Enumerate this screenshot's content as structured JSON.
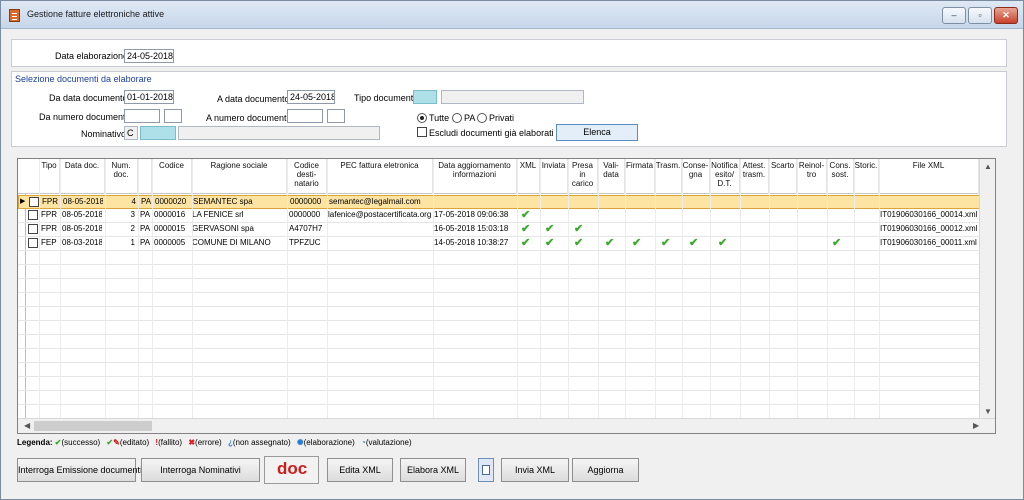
{
  "window": {
    "title": "Gestione fatture elettroniche attive",
    "min": "–",
    "max": "▫",
    "close": "✕"
  },
  "top": {
    "data_elab_label": "Data elaborazione:",
    "data_elab_value": "24-05-2018"
  },
  "selection": {
    "title": "Selezione documenti da elaborare",
    "da_data_label": "Da data documento:",
    "da_data_value": "01-01-2018",
    "a_data_label": "A data documento:",
    "a_data_value": "24-05-2018",
    "tipo_label": "Tipo documento:",
    "da_num_label": "Da numero documento:",
    "a_num_label": "A numero documento:",
    "nominativo_label": "Nominativo:",
    "nominativo_code": "C",
    "radio_tutte": "Tutte",
    "radio_pa": "PA",
    "radio_privati": "Privati",
    "escludi_label": "Escludi documenti già elaborati",
    "elenca_label": "Elenca"
  },
  "grid": {
    "columns": [
      "Tipo",
      "Data doc.",
      "Num. doc.",
      "",
      "Codice",
      "Ragione sociale",
      "Codice desti- natario",
      "PEC fattura eletronica",
      "Data aggiornamento informazioni",
      "XML",
      "Inviata",
      "Presa in carico",
      "Vali- data",
      "Firmata",
      "Trasm.",
      "Conse- gna",
      "Notifica esito/ D.T.",
      "Attest. trasm.",
      "Scarto",
      "Reinol- tro",
      "Cons. sost.",
      "Storic.",
      "File XML"
    ],
    "rows": [
      {
        "tipo": "FPR",
        "data": "08-05-2018",
        "num": "4",
        "pa": "PA",
        "codice": "0000020",
        "ragione": "SEMANTEC spa",
        "dest": "0000000",
        "pec": "semantec@legalmail.com",
        "agg": "",
        "file": "",
        "checks": []
      },
      {
        "tipo": "FPR",
        "data": "08-05-2018",
        "num": "3",
        "pa": "PA",
        "codice": "0000016",
        "ragione": "LA FENICE srl",
        "dest": "0000000",
        "pec": "lafenice@postacertificata.org",
        "agg": "17-05-2018 09:06:38",
        "file": "IT01906030166_00014.xml",
        "checks": [
          "xml"
        ]
      },
      {
        "tipo": "FPR",
        "data": "08-05-2018",
        "num": "2",
        "pa": "PA",
        "codice": "0000015",
        "ragione": "GERVASONI spa",
        "dest": "A4707H7",
        "pec": "",
        "agg": "16-05-2018 15:03:18",
        "file": "IT01906030166_00012.xml",
        "checks": [
          "xml",
          "inviata",
          "presa"
        ]
      },
      {
        "tipo": "FEP",
        "data": "08-03-2018",
        "num": "1",
        "pa": "PA",
        "codice": "0000005",
        "ragione": "COMUNE DI MILANO",
        "dest": "TPFZUC",
        "pec": "",
        "agg": "14-05-2018 10:38:27",
        "file": "IT01906030166_00011.xml",
        "checks": [
          "xml",
          "inviata",
          "presa",
          "validata",
          "firmata",
          "trasm",
          "consegna",
          "notifica",
          "cons"
        ]
      }
    ],
    "check_glyph": "✔"
  },
  "legend": {
    "title": "Legenda:",
    "successo": "(successo)",
    "editato": "(editato)",
    "fallito": "(fallito)",
    "errore": "(errore)",
    "non_assegnato": "(non assegnato)",
    "elaborazione": "(elaborazione)",
    "valutazione": "(valutazione)"
  },
  "buttons": {
    "interroga_emissione": "Interroga Emissione documenti",
    "interroga_nominativi": "Interroga Nominativi",
    "doc": "doc",
    "edita_xml": "Edita XML",
    "elabora_xml": "Elabora XML",
    "invia_xml": "Invia XML",
    "aggiorna": "Aggiorna"
  }
}
